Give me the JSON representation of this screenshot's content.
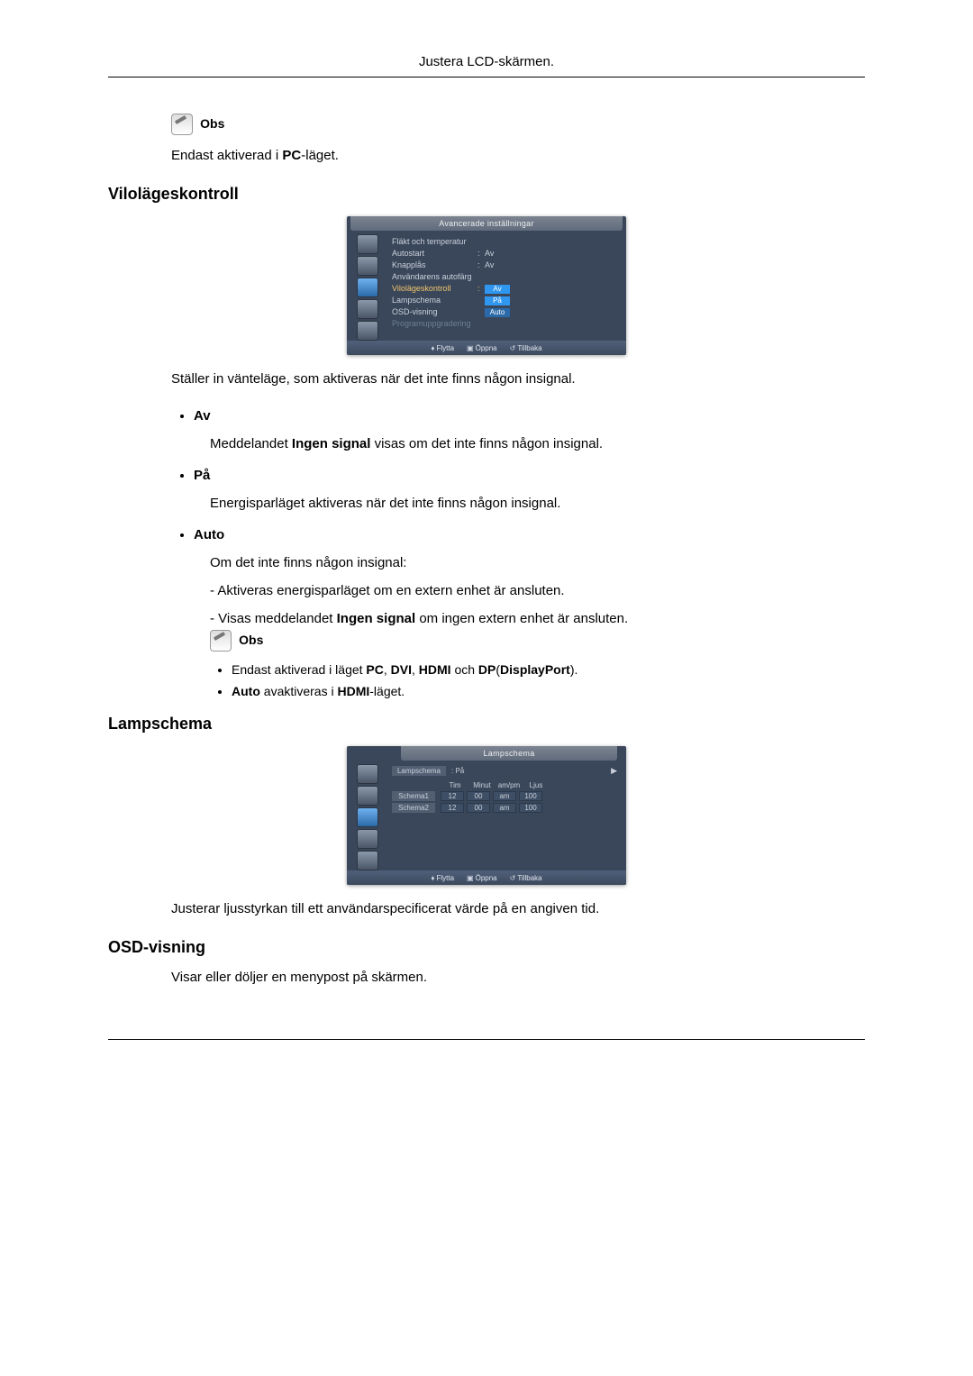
{
  "header": "Justera LCD-skärmen.",
  "note_label": "Obs",
  "note1_text_prefix": "Endast aktiverad i ",
  "note1_text_bold": "PC",
  "note1_text_suffix": "-läget.",
  "section_sleep": "Vilolägeskontroll",
  "osd1": {
    "title": "Avancerade inställningar",
    "rows": {
      "fan": "Fläkt och temperatur",
      "autostart": "Autostart",
      "autostart_val": "Av",
      "keylock": "Knapplås",
      "keylock_val": "Av",
      "usercolor": "Användarens autofärg",
      "sleep": "Vilolägeskontroll",
      "sleep_val": "Av",
      "lamp": "Lampschema",
      "lamp_val": "På",
      "osdview": "OSD-visning",
      "osdview_val": "Auto",
      "upgrade": "Programuppgradering"
    },
    "footer": {
      "move": "Flytta",
      "open": "Öppna",
      "back": "Tillbaka"
    }
  },
  "sleep_intro": "Ställer in vänteläge, som aktiveras när det inte finns någon insignal.",
  "opt_av_label": "Av",
  "opt_av_desc_prefix": "Meddelandet ",
  "opt_av_desc_bold": "Ingen signal",
  "opt_av_desc_suffix": " visas om det inte finns någon insignal.",
  "opt_pa_label": "På",
  "opt_pa_desc": "Energisparläget aktiveras när det inte finns någon insignal.",
  "opt_auto_label": "Auto",
  "opt_auto_intro": "Om det inte finns någon insignal:",
  "opt_auto_l1": "- Aktiveras energisparläget om en extern enhet är ansluten.",
  "opt_auto_l2_prefix": "- Visas meddelandet ",
  "opt_auto_l2_bold": "Ingen signal",
  "opt_auto_l2_suffix": " om ingen extern enhet är ansluten.",
  "subnote1_prefix": "Endast aktiverad i läget ",
  "subnote1_b1": "PC",
  "subnote1_m1": ", ",
  "subnote1_b2": "DVI",
  "subnote1_m2": ", ",
  "subnote1_b3": "HDMI",
  "subnote1_m3": " och ",
  "subnote1_b4": "DP",
  "subnote1_m4": "(",
  "subnote1_b5": "DisplayPort",
  "subnote1_m5": ").",
  "subnote2_b1": "Auto",
  "subnote2_m1": " avaktiveras i ",
  "subnote2_b2": "HDMI",
  "subnote2_m2": "-läget.",
  "section_lamp": "Lampschema",
  "osd2": {
    "title": "Lampschema",
    "top_label": "Lampschema",
    "top_val": ": På",
    "headers": {
      "h1": "Tim",
      "h2": "Minut",
      "h3": "am/pm",
      "h4": "Ljus"
    },
    "rows": [
      {
        "tag": "Schema1",
        "v": [
          "12",
          "00",
          "am",
          "100"
        ]
      },
      {
        "tag": "Schema2",
        "v": [
          "12",
          "00",
          "am",
          "100"
        ]
      }
    ],
    "footer": {
      "move": "Flytta",
      "open": "Öppna",
      "back": "Tillbaka"
    }
  },
  "lamp_desc": "Justerar ljusstyrkan till ett användarspecificerat värde på en angiven tid.",
  "section_osd": "OSD-visning",
  "osd_desc": "Visar eller döljer en menypost på skärmen."
}
